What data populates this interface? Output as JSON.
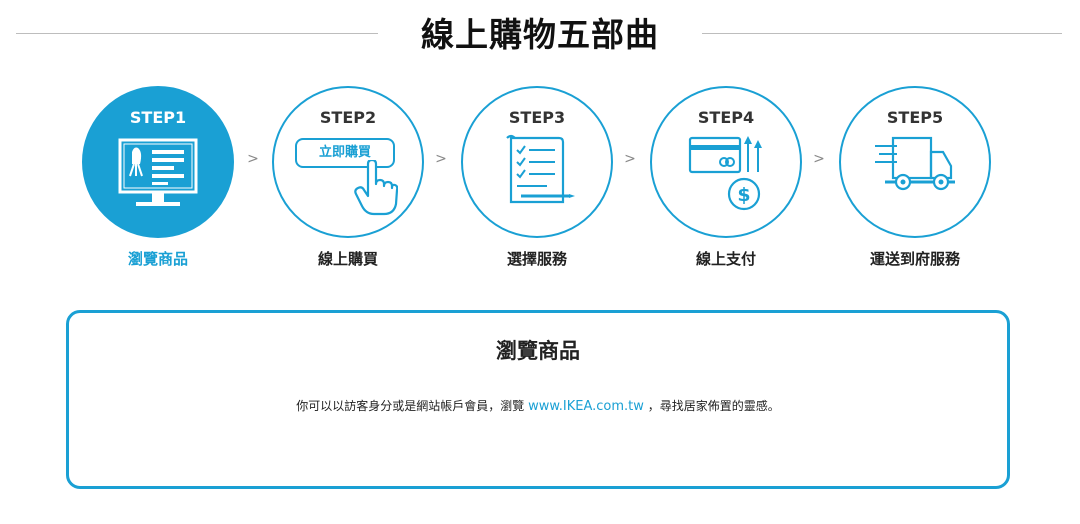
{
  "page_title": "線上購物五部曲",
  "steps": [
    {
      "num": "STEP1",
      "label": "瀏覽商品",
      "icon": "monitor-chair-icon",
      "active": true
    },
    {
      "num": "STEP2",
      "label": "線上購買",
      "icon": "buy-button-hand-icon",
      "button_text": "立即購買",
      "active": false
    },
    {
      "num": "STEP3",
      "label": "選擇服務",
      "icon": "checklist-pen-icon",
      "active": false
    },
    {
      "num": "STEP4",
      "label": "線上支付",
      "icon": "card-dollar-icon",
      "active": false
    },
    {
      "num": "STEP5",
      "label": "運送到府服務",
      "icon": "delivery-truck-icon",
      "active": false
    }
  ],
  "separator": ">",
  "detail": {
    "title": "瀏覽商品",
    "text_before": "你可以以訪客身分或是網站帳戶會員，瀏覽 ",
    "link": "www.IKEA.com.tw",
    "text_after": " ，尋找居家佈置的靈感。"
  },
  "colors": {
    "accent": "#1aa0d4",
    "text": "#111111",
    "line": "#bdbdbd"
  }
}
